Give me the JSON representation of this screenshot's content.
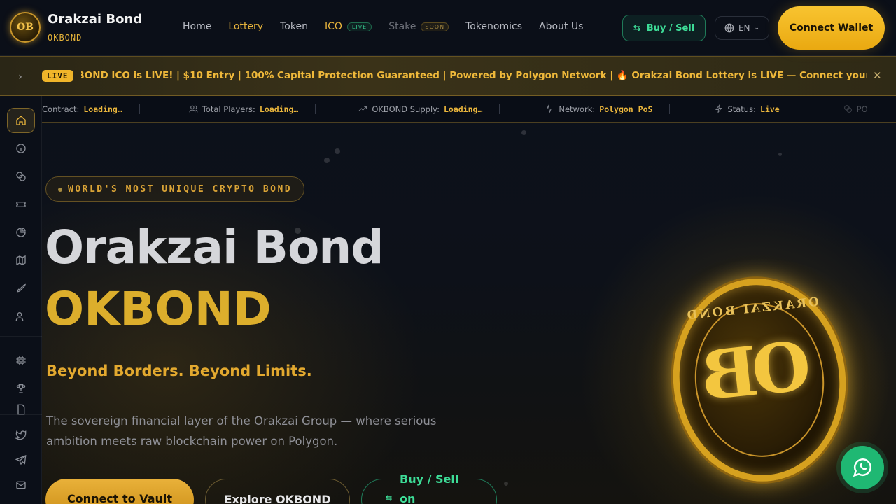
{
  "brand": {
    "name": "Orakzai Bond",
    "ticker": "OKBOND",
    "logo_text": "OB"
  },
  "nav": {
    "items": [
      {
        "label": "Home",
        "state": "normal"
      },
      {
        "label": "Lottery",
        "state": "active"
      },
      {
        "label": "Token",
        "state": "normal"
      },
      {
        "label": "ICO",
        "state": "active",
        "badge": "LIVE"
      },
      {
        "label": "Stake",
        "state": "muted",
        "badge": "SOON"
      },
      {
        "label": "Tokenomics",
        "state": "normal"
      },
      {
        "label": "About Us",
        "state": "normal"
      }
    ]
  },
  "header_actions": {
    "buy_sell_label": "Buy / Sell",
    "language": "EN",
    "connect_wallet_label": "Connect Wallet"
  },
  "ticker": {
    "live_label": "LIVE",
    "text": "KBOND ICO is LIVE! | $10 Entry | 100% Capital Protection Guaranteed | Powered by Polygon Network | 🔥 Orakzai Bond Lottery is LIVE — Connect your wallet and enter now"
  },
  "stats": [
    {
      "icon": "",
      "label": "Contract:",
      "value": "Loading…"
    },
    {
      "icon": "users-icon",
      "label": "Total Players:",
      "value": "Loading…"
    },
    {
      "icon": "trend-icon",
      "label": "OKBOND Supply:",
      "value": "Loading…"
    },
    {
      "icon": "pulse-icon",
      "label": "Network:",
      "value": "Polygon PoS"
    },
    {
      "icon": "bolt-icon",
      "label": "Status:",
      "value": "Live"
    },
    {
      "icon": "coins-icon",
      "label": "PO",
      "value": ""
    }
  ],
  "sidebar": {
    "items": [
      "home-icon",
      "info-icon",
      "coins-icon",
      "ticket-icon",
      "pie-chart-icon",
      "map-icon",
      "rocket-icon",
      "users-icon",
      "chip-icon",
      "trophy-icon",
      "document-icon",
      "twitter-icon",
      "telegram-icon",
      "mail-icon"
    ]
  },
  "hero": {
    "badge": "WORLD'S MOST UNIQUE CRYPTO BOND",
    "title": "Orakzai Bond",
    "subtitle": "OKBOND",
    "tagline": "Beyond Borders. Beyond Limits.",
    "description": "The sovereign financial layer of the Orakzai Group — where serious ambition meets raw blockchain power on Polygon.",
    "btn_vault": "Connect to Vault",
    "btn_explore": "Explore OKBOND",
    "btn_buy_line1": "Buy / Sell",
    "btn_buy_line2": "on"
  },
  "coin": {
    "ring_text": "ORAKZAI BOND",
    "monogram": "OB"
  },
  "colors": {
    "accent": "#e9b53c",
    "green": "#3ddc97",
    "background": "#0b0f18",
    "whatsapp": "#1fb873"
  }
}
